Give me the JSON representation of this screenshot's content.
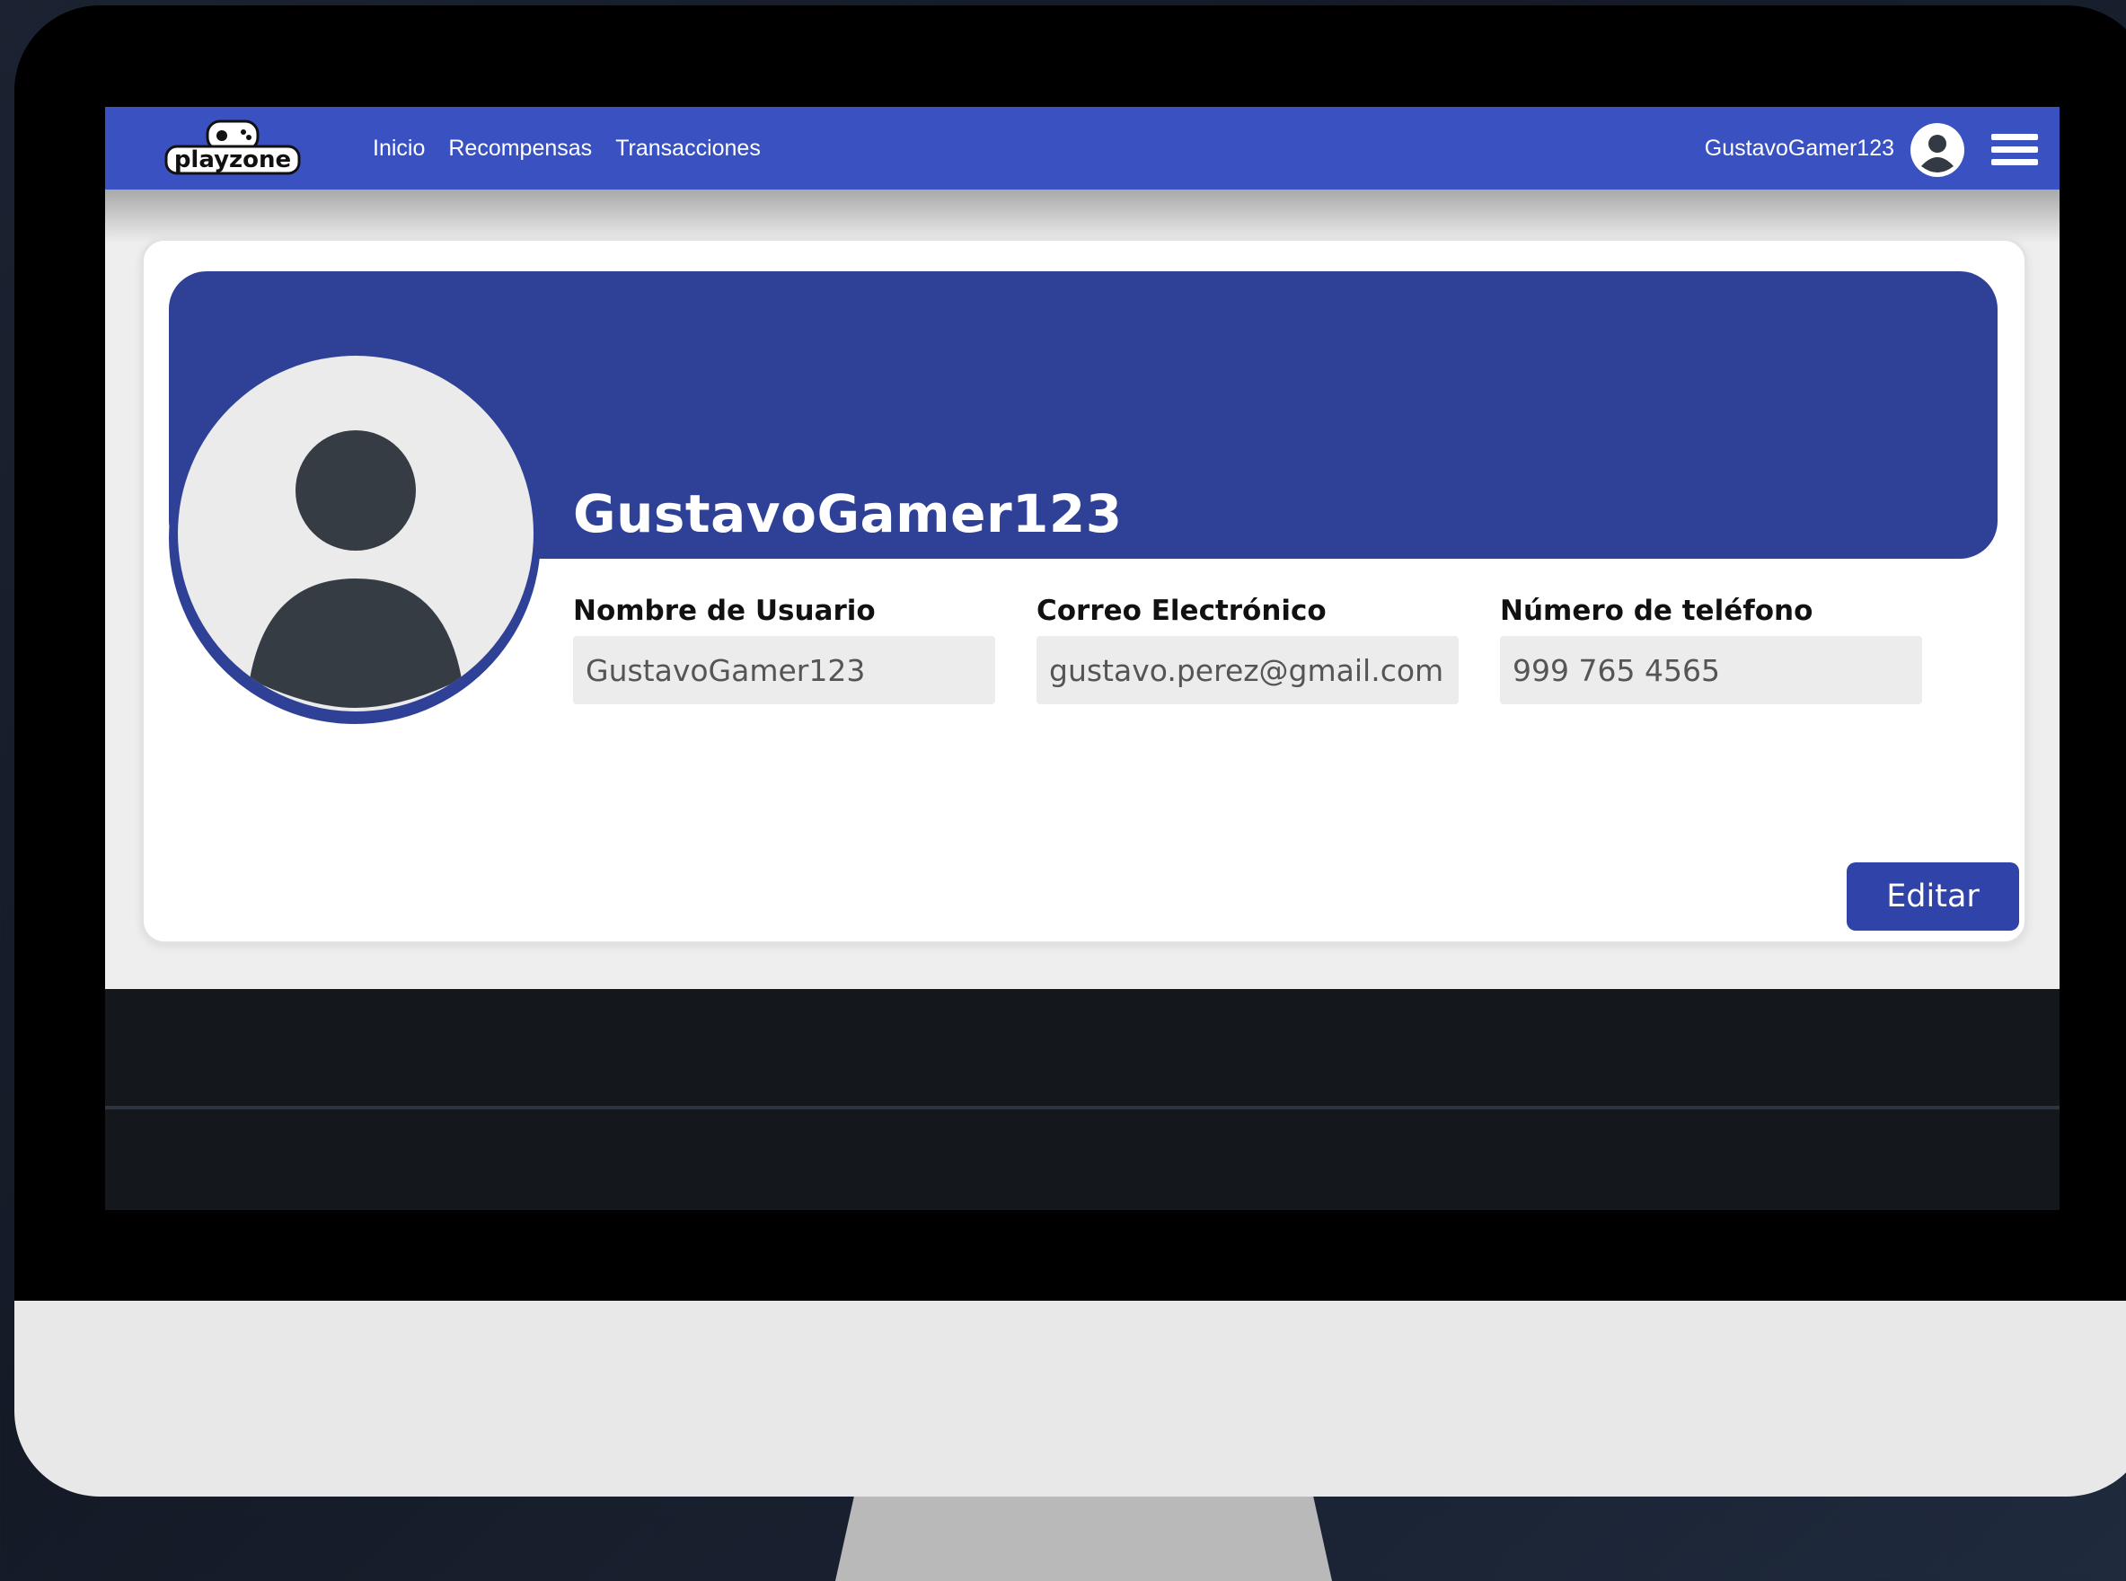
{
  "navbar": {
    "logo_text": "playzone",
    "links": [
      {
        "label": "Inicio"
      },
      {
        "label": "Recompensas"
      },
      {
        "label": "Transacciones"
      }
    ],
    "username": "GustavoGamer123",
    "accent_color": "#3a52c1"
  },
  "profile": {
    "name": "GustavoGamer123",
    "banner_color": "#2f4196",
    "fields": [
      {
        "label": "Nombre de Usuario",
        "value": "GustavoGamer123"
      },
      {
        "label": "Correo Electrónico",
        "value": "gustavo.perez@gmail.com"
      },
      {
        "label": "Número de teléfono",
        "value": "999 765 4565"
      }
    ],
    "edit_label": "Editar"
  },
  "icons": {
    "avatar": "user-icon",
    "menu": "hamburger-menu-icon",
    "logo": "gamepad-icon"
  }
}
